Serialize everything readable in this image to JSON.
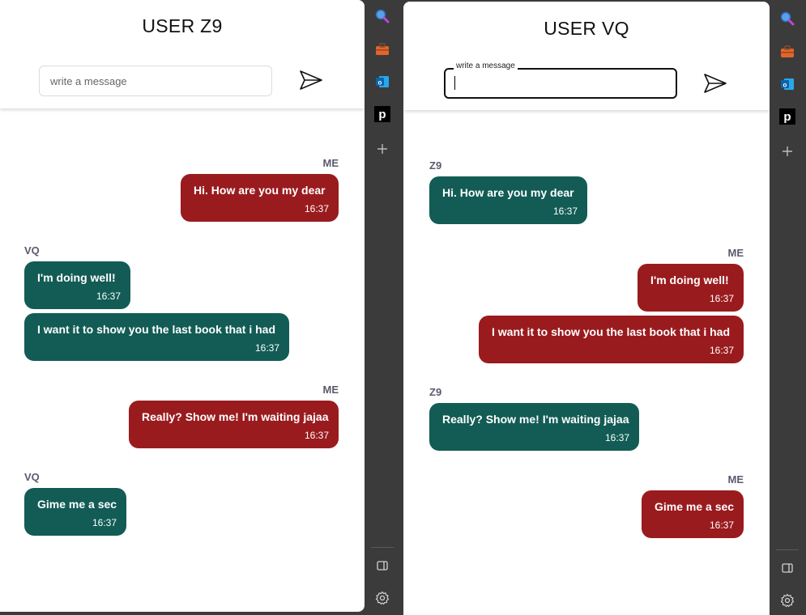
{
  "left": {
    "title": "USER Z9",
    "input": {
      "placeholder": "write a message",
      "value": ""
    },
    "messages": [
      {
        "sender": "ME",
        "text": "Hi. How are you my dear",
        "time": "16:37"
      },
      {
        "sender": "VQ",
        "text": "I'm doing well!",
        "time": "16:37"
      },
      {
        "text": "I want it to show you the last book that i had",
        "time": "16:37"
      },
      {
        "sender": "ME",
        "text": "Really? Show me! I'm waiting jajaa",
        "time": "16:37"
      },
      {
        "sender": "VQ",
        "text": "Gime me a sec",
        "time": "16:37"
      }
    ]
  },
  "right": {
    "title": "USER VQ",
    "input": {
      "label": "write a message",
      "value": ""
    },
    "messages": [
      {
        "sender": "Z9",
        "text": "Hi. How are you my dear",
        "time": "16:37"
      },
      {
        "sender": "ME",
        "text": "I'm doing well!",
        "time": "16:37"
      },
      {
        "text": "I want it to show you the last book that i had",
        "time": "16:37"
      },
      {
        "sender": "Z9",
        "text": "Really? Show me! I'm waiting jajaa",
        "time": "16:37"
      },
      {
        "sender": "ME",
        "text": "Gime me a sec",
        "time": "16:37"
      }
    ]
  },
  "toolbar": {
    "icons": [
      "search-icon",
      "toolbox-icon",
      "outlook-icon",
      "pinterest-icon",
      "add-icon",
      "sidebar-toggle-icon",
      "settings-icon"
    ],
    "pinterest_glyph": "p"
  },
  "colors": {
    "outgoing_bubble": "#9a1b1e",
    "incoming_bubble": "#125c55",
    "toolbar_bg": "#3b3b3b"
  }
}
